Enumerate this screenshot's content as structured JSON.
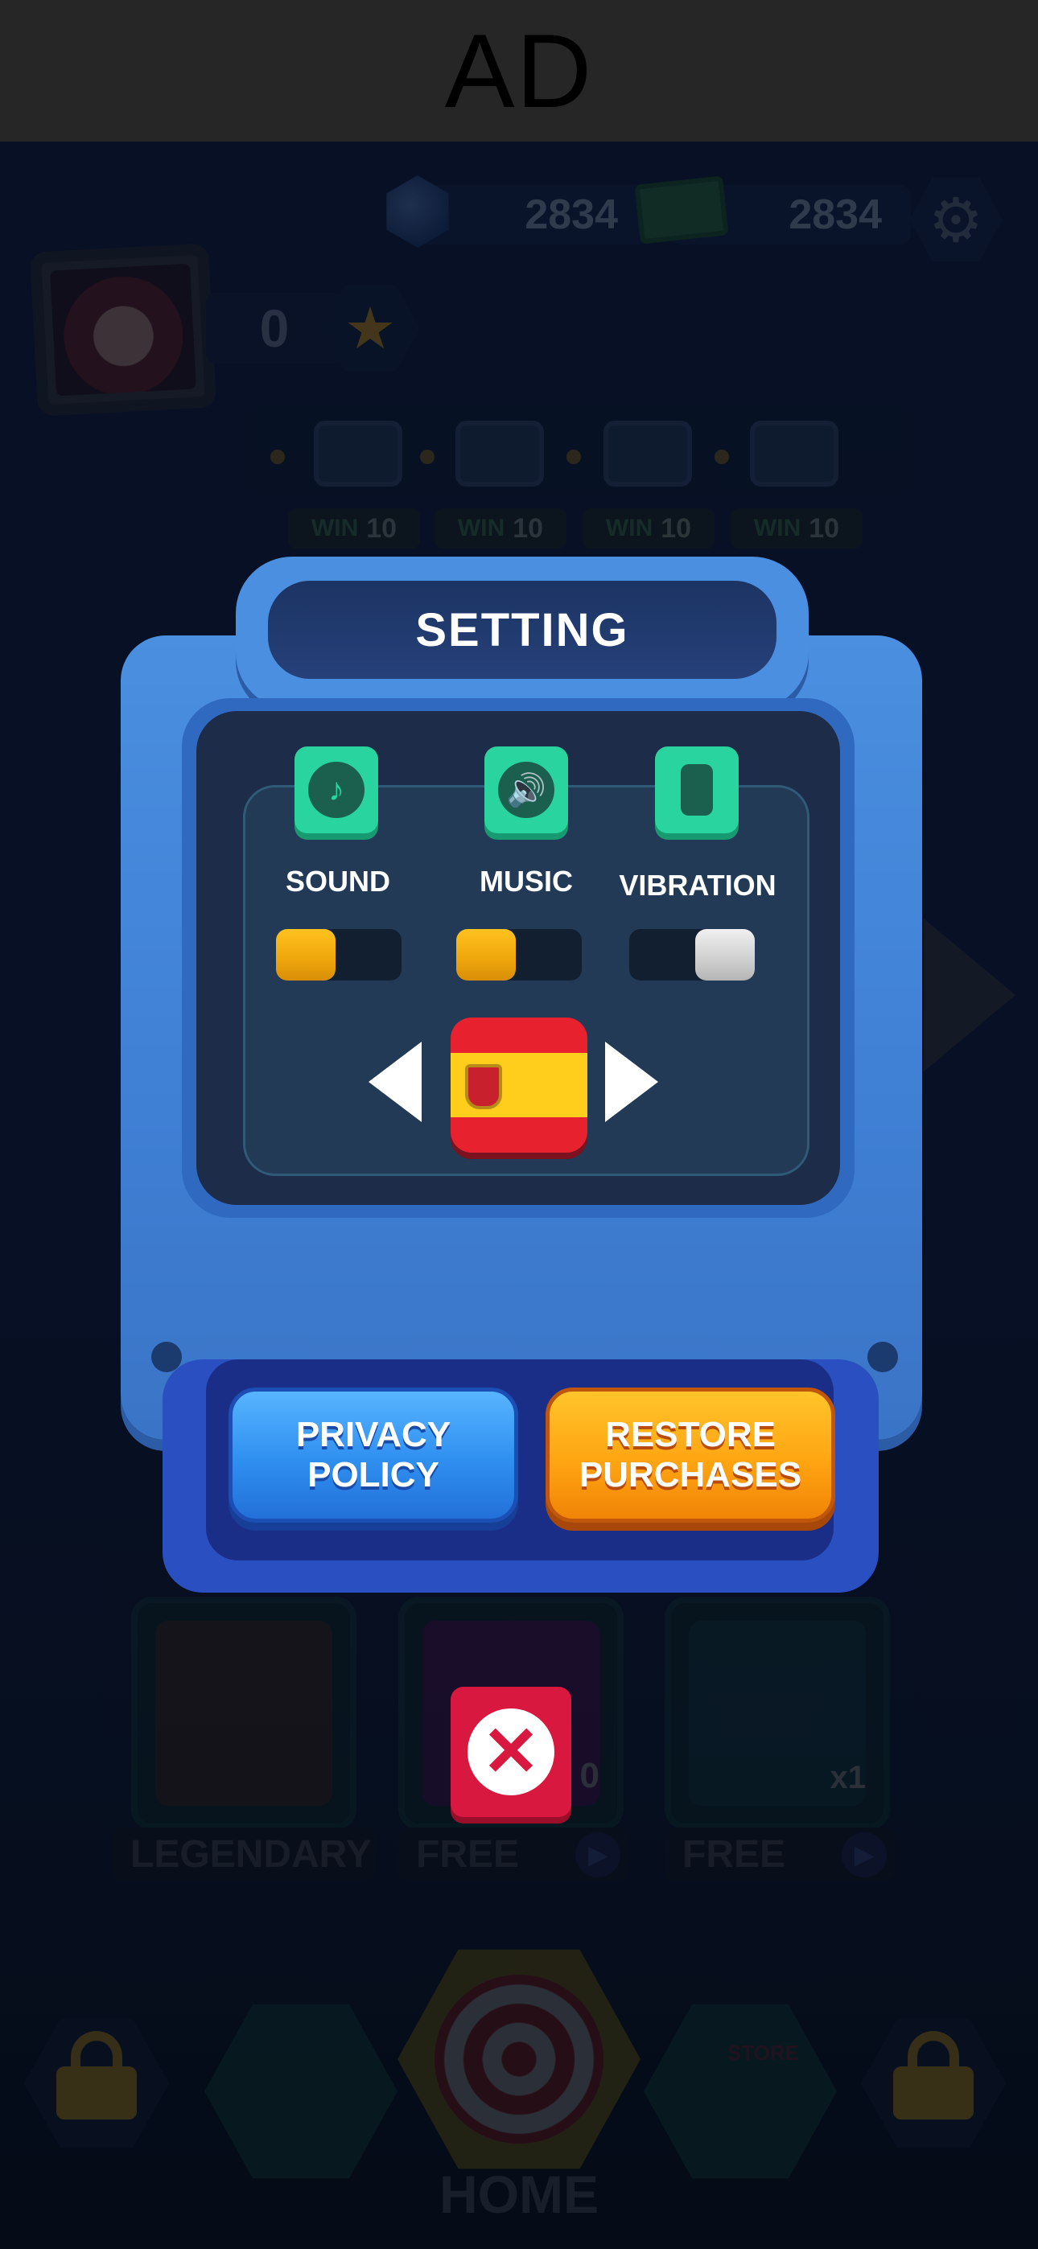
{
  "ad": {
    "label": "AD"
  },
  "currency": {
    "gems": "2834",
    "cash": "2834"
  },
  "profile": {
    "level": "0"
  },
  "chest_track": {
    "win_badges": [
      {
        "label": "WIN",
        "value": "10"
      },
      {
        "label": "WIN",
        "value": "10"
      },
      {
        "label": "WIN",
        "value": "10"
      },
      {
        "label": "WIN",
        "value": "10"
      }
    ]
  },
  "rewards": {
    "items": [
      {
        "label": "LEGENDARY"
      },
      {
        "label": "FREE",
        "badge": "0"
      },
      {
        "label": "FREE",
        "badge": "x1"
      }
    ]
  },
  "nav": {
    "home_label": "HOME",
    "store_sign": "STORE"
  },
  "settings": {
    "title": "SETTING",
    "options": [
      {
        "label": "SOUND",
        "icon": "music-note-icon",
        "enabled": true
      },
      {
        "label": "MUSIC",
        "icon": "speaker-icon",
        "enabled": true
      },
      {
        "label": "VIBRATION",
        "icon": "vibration-icon",
        "enabled": false
      }
    ],
    "language": {
      "flag": "spain-flag"
    },
    "privacy_label": "PRIVACY\nPOLICY",
    "restore_label": "RESTORE\nPURCHASES",
    "close_symbol": "✕"
  },
  "colors": {
    "panel_blue": "#4a8fe0",
    "toggle_on": "#f0a80d",
    "toggle_off": "#cfcfcf",
    "icon_green": "#2ad49e",
    "privacy_blue": "#2f8ff0",
    "restore_orange": "#ffa512",
    "close_red": "#d8183e"
  }
}
